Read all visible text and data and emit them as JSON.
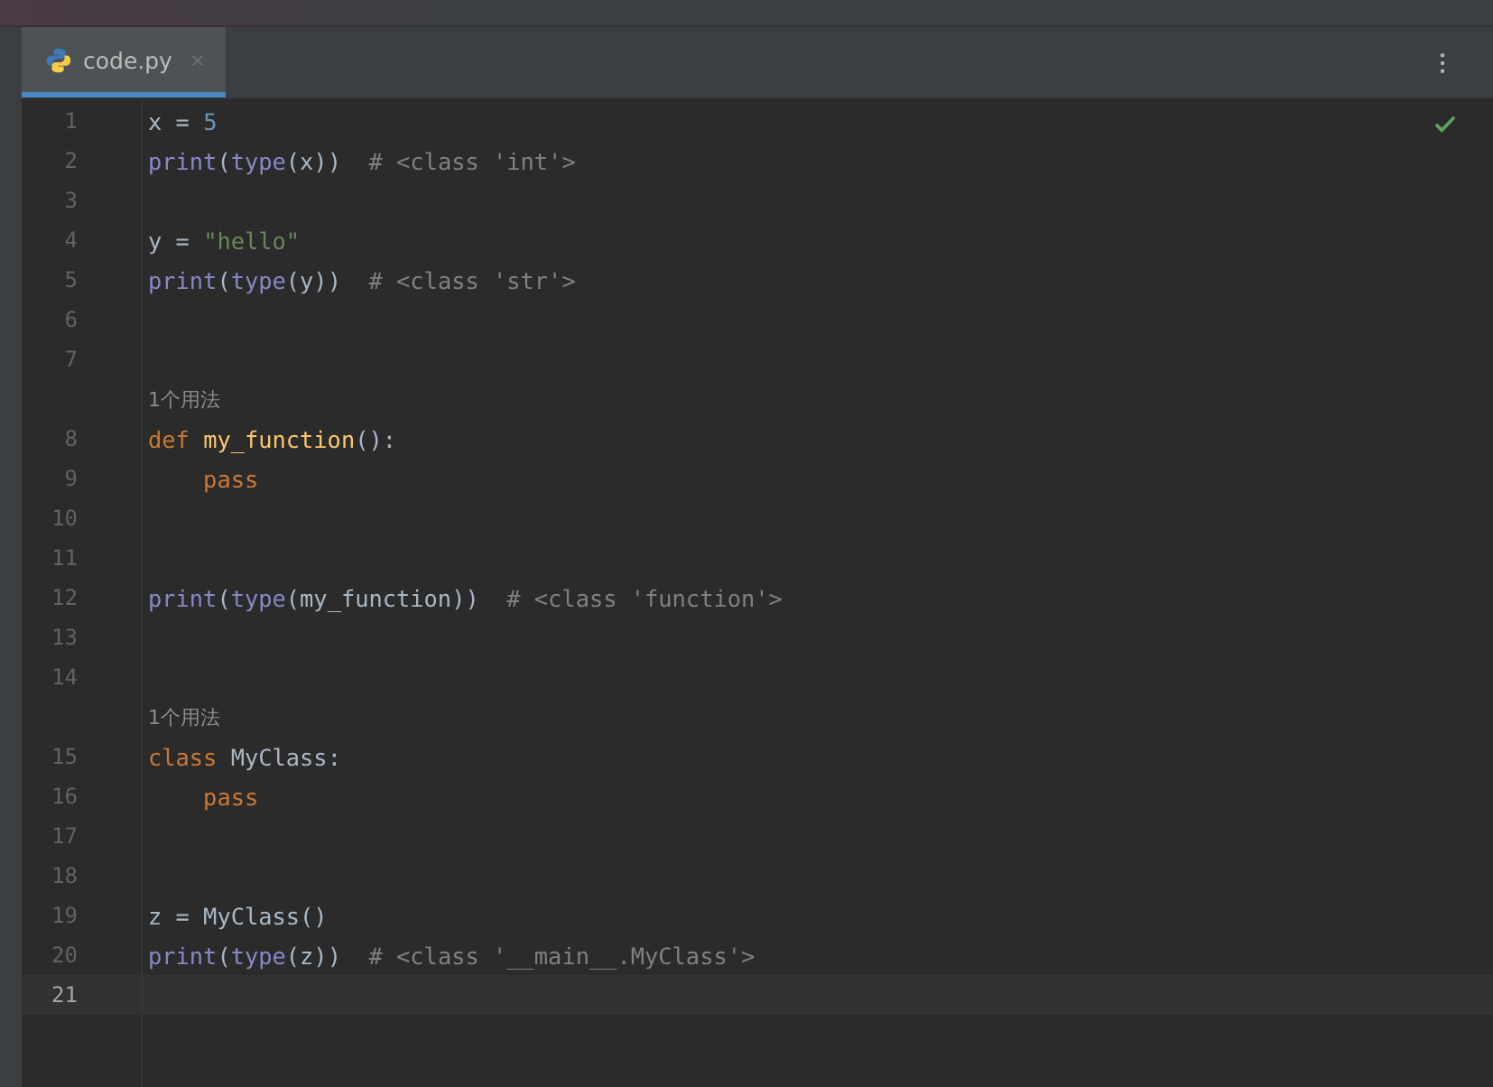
{
  "tabs": [
    {
      "label": "code.py",
      "selected": true
    }
  ],
  "status": {
    "inspection_ok": true
  },
  "lines": [
    {
      "kind": "code",
      "number": "1",
      "current": false,
      "tokens": [
        {
          "kind": "plain",
          "text": "x = "
        },
        {
          "kind": "number",
          "text": "5"
        }
      ]
    },
    {
      "kind": "code",
      "number": "2",
      "current": false,
      "tokens": [
        {
          "kind": "builtin",
          "text": "print"
        },
        {
          "kind": "plain",
          "text": "("
        },
        {
          "kind": "builtin",
          "text": "type"
        },
        {
          "kind": "plain",
          "text": "(x))  "
        },
        {
          "kind": "comment",
          "text": "# <class 'int'>"
        }
      ]
    },
    {
      "kind": "code",
      "number": "3",
      "current": false
    },
    {
      "kind": "code",
      "number": "4",
      "current": false,
      "tokens": [
        {
          "kind": "plain",
          "text": "y = "
        },
        {
          "kind": "string",
          "text": "\"hello\""
        }
      ]
    },
    {
      "kind": "code",
      "number": "5",
      "current": false,
      "tokens": [
        {
          "kind": "builtin",
          "text": "print"
        },
        {
          "kind": "plain",
          "text": "("
        },
        {
          "kind": "builtin",
          "text": "type"
        },
        {
          "kind": "plain",
          "text": "(y))  "
        },
        {
          "kind": "comment",
          "text": "# <class 'str'>"
        }
      ]
    },
    {
      "kind": "code",
      "number": "6",
      "current": false
    },
    {
      "kind": "code",
      "number": "7",
      "current": false
    },
    {
      "kind": "hint",
      "text": "1个用法"
    },
    {
      "kind": "code",
      "number": "8",
      "current": false,
      "tokens": [
        {
          "kind": "keyword",
          "text": "def "
        },
        {
          "kind": "funcdef",
          "text": "my_function"
        },
        {
          "kind": "plain",
          "text": "():"
        }
      ]
    },
    {
      "kind": "code",
      "number": "9",
      "current": false,
      "tokens": [
        {
          "kind": "keyword",
          "text": "    pass"
        }
      ]
    },
    {
      "kind": "code",
      "number": "10",
      "current": false
    },
    {
      "kind": "code",
      "number": "11",
      "current": false
    },
    {
      "kind": "code",
      "number": "12",
      "current": false,
      "tokens": [
        {
          "kind": "builtin",
          "text": "print"
        },
        {
          "kind": "plain",
          "text": "("
        },
        {
          "kind": "builtin",
          "text": "type"
        },
        {
          "kind": "plain",
          "text": "(my_function))  "
        },
        {
          "kind": "comment",
          "text": "# <class 'function'>"
        }
      ]
    },
    {
      "kind": "code",
      "number": "13",
      "current": false
    },
    {
      "kind": "code",
      "number": "14",
      "current": false
    },
    {
      "kind": "hint",
      "text": "1个用法"
    },
    {
      "kind": "code",
      "number": "15",
      "current": false,
      "tokens": [
        {
          "kind": "keyword",
          "text": "class "
        },
        {
          "kind": "plain",
          "text": "MyClass:"
        }
      ]
    },
    {
      "kind": "code",
      "number": "16",
      "current": false,
      "tokens": [
        {
          "kind": "keyword",
          "text": "    pass"
        }
      ]
    },
    {
      "kind": "code",
      "number": "17",
      "current": false
    },
    {
      "kind": "code",
      "number": "18",
      "current": false
    },
    {
      "kind": "code",
      "number": "19",
      "current": false,
      "tokens": [
        {
          "kind": "plain",
          "text": "z = MyClass()"
        }
      ]
    },
    {
      "kind": "code",
      "number": "20",
      "current": false,
      "tokens": [
        {
          "kind": "builtin",
          "text": "print"
        },
        {
          "kind": "plain",
          "text": "("
        },
        {
          "kind": "builtin",
          "text": "type"
        },
        {
          "kind": "plain",
          "text": "(z))  "
        },
        {
          "kind": "comment",
          "text": "# <class '__main__.MyClass'>"
        }
      ]
    },
    {
      "kind": "code",
      "number": "21",
      "current": true
    }
  ]
}
